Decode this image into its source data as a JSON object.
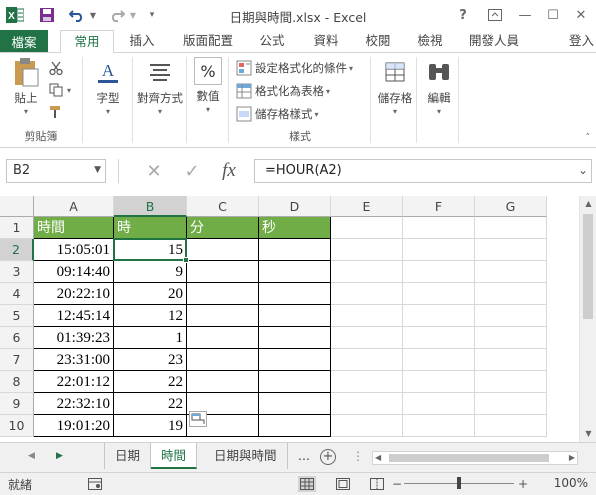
{
  "window": {
    "title": "日期與時間.xlsx - Excel",
    "help": "?",
    "restore_icon": "ribbon-display-icon",
    "minimize": "—",
    "maximize": "☐",
    "close": "✕"
  },
  "quick_access": {
    "app_icon": "excel-icon",
    "save_icon": "save-icon",
    "undo_icon": "undo-icon",
    "redo_icon": "redo-icon",
    "customize_icon": "customize-icon"
  },
  "ribbon_tabs": {
    "file": "檔案",
    "items": [
      "常用",
      "插入",
      "版面配置",
      "公式",
      "資料",
      "校閱",
      "檢視",
      "開發人員"
    ],
    "active_index": 0,
    "signin": "登入"
  },
  "ribbon": {
    "clipboard": {
      "paste": "貼上",
      "group_label": "剪貼簿"
    },
    "font": {
      "label": "字型"
    },
    "alignment": {
      "label": "對齊方式"
    },
    "number": {
      "label": "數值",
      "icon_text": "%"
    },
    "styles": {
      "conditional": "設定格式化的條件",
      "as_table": "格式化為表格",
      "cell_styles": "儲存格樣式",
      "group_label": "樣式"
    },
    "cells": {
      "label": "儲存格"
    },
    "editing": {
      "label": "編輯"
    }
  },
  "formula_bar": {
    "name_box": "B2",
    "cancel": "✕",
    "enter": "✓",
    "fx": "fx",
    "formula": "=HOUR(A2)"
  },
  "grid": {
    "columns": [
      "A",
      "B",
      "C",
      "D",
      "E",
      "F",
      "G"
    ],
    "selected_column": "B",
    "rows": [
      "1",
      "2",
      "3",
      "4",
      "5",
      "6",
      "7",
      "8",
      "9",
      "10"
    ],
    "selected_row": "2",
    "header_row": [
      "時間",
      "時",
      "分",
      "秒"
    ],
    "data": [
      [
        "15:05:01",
        "15"
      ],
      [
        "09:14:40",
        "9"
      ],
      [
        "20:22:10",
        "20"
      ],
      [
        "12:45:14",
        "12"
      ],
      [
        "01:39:23",
        "1"
      ],
      [
        "23:31:00",
        "23"
      ],
      [
        "22:01:12",
        "22"
      ],
      [
        "22:32:10",
        "22"
      ],
      [
        "19:01:20",
        "19"
      ]
    ],
    "header_color": "#70ad47",
    "accent_color": "#217346"
  },
  "sheets": {
    "tabs": [
      "日期",
      "時間",
      "日期與時間"
    ],
    "active_index": 1,
    "more": "...",
    "add": "+"
  },
  "status": {
    "ready": "就緒",
    "zoom_minus": "−",
    "zoom_plus": "+",
    "zoom": "100%",
    "zoom_value": 100
  }
}
